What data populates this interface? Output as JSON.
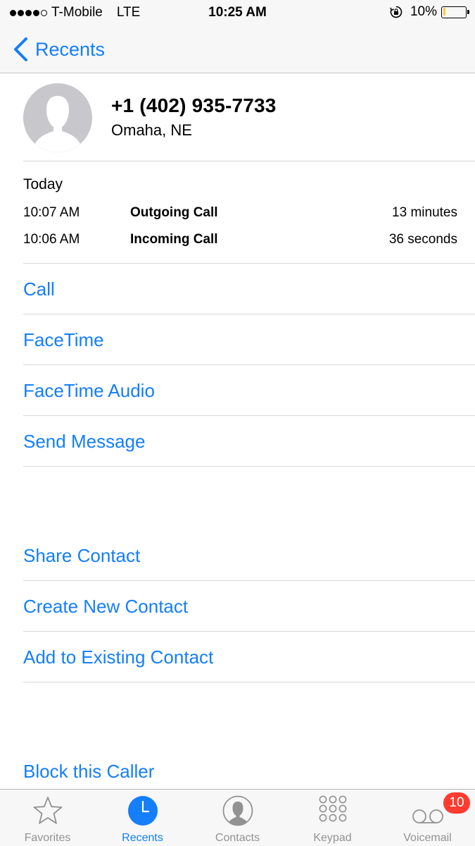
{
  "status_bar": {
    "signal_dots_filled": 4,
    "signal_dots_total": 5,
    "carrier": "T-Mobile",
    "network": "LTE",
    "time": "10:25 AM",
    "battery_percent_label": "10%",
    "battery_level": 0.1,
    "battery_color": "#f4cd3f",
    "orientation_lock_icon": "rotation-lock-icon"
  },
  "nav": {
    "back_label": "Recents",
    "back_icon": "chevron-left-icon"
  },
  "contact": {
    "avatar_icon": "person-silhouette-icon",
    "phone_number": "+1 (402) 935-7733",
    "location": "Omaha, NE"
  },
  "call_log": {
    "day": "Today",
    "entries": [
      {
        "time": "10:07 AM",
        "type": "Outgoing Call",
        "duration": "13 minutes"
      },
      {
        "time": "10:06 AM",
        "type": "Incoming Call",
        "duration": "36 seconds"
      }
    ]
  },
  "actions": {
    "call": "Call",
    "facetime": "FaceTime",
    "facetime_audio": "FaceTime Audio",
    "send_message": "Send Message",
    "share_contact": "Share Contact",
    "create_new_contact": "Create New Contact",
    "add_to_existing_contact": "Add to Existing Contact",
    "block_caller": "Block this Caller"
  },
  "tab_bar": {
    "tabs": [
      {
        "label": "Favorites",
        "icon": "star-icon"
      },
      {
        "label": "Recents",
        "icon": "clock-icon",
        "active": true
      },
      {
        "label": "Contacts",
        "icon": "contact-icon"
      },
      {
        "label": "Keypad",
        "icon": "keypad-icon"
      },
      {
        "label": "Voicemail",
        "icon": "voicemail-icon",
        "badge": "10"
      }
    ]
  },
  "colors": {
    "accent": "#147efb",
    "badge": "#ff3b30",
    "inactive_tab": "#929292",
    "bar_background": "#f7f7f7"
  }
}
